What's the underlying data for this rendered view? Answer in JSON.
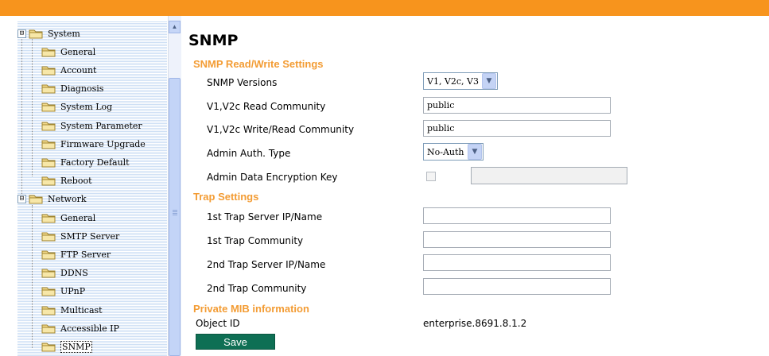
{
  "sidebar": {
    "groups": [
      {
        "label": "System",
        "expander": "⊟",
        "items": [
          "General",
          "Account",
          "Diagnosis",
          "System Log",
          "System Parameter",
          "Firmware Upgrade",
          "Factory Default",
          "Reboot"
        ]
      },
      {
        "label": "Network",
        "expander": "⊟",
        "items": [
          "General",
          "SMTP Server",
          "FTP Server",
          "DDNS",
          "UPnP",
          "Multicast",
          "Accessible IP",
          "SNMP"
        ]
      }
    ],
    "selected_item": "SNMP",
    "scroll_up_glyph": "▲"
  },
  "main": {
    "title": "SNMP",
    "rw_section": {
      "heading": "SNMP Read/Write Settings",
      "versions_label": "SNMP Versions",
      "versions_value": "V1, V2c, V3",
      "read_community_label": "V1,V2c Read Community",
      "read_community_value": "public",
      "write_community_label": "V1,V2c Write/Read Community",
      "write_community_value": "public",
      "auth_type_label": "Admin Auth. Type",
      "auth_type_value": "No-Auth",
      "encryption_key_label": "Admin Data Encryption Key",
      "encryption_key_checked": false,
      "encryption_key_value": ""
    },
    "trap_section": {
      "heading": "Trap Settings",
      "server1_label": "1st Trap Server IP/Name",
      "server1_value": "",
      "community1_label": "1st Trap Community",
      "community1_value": "",
      "server2_label": "2nd Trap Server IP/Name",
      "server2_value": "",
      "community2_label": "2nd Trap Community",
      "community2_value": ""
    },
    "mib_section": {
      "heading": "Private MIB information",
      "object_id_label": "Object ID",
      "object_id_value": "enterprise.8691.8.1.2"
    },
    "save_label": "Save",
    "dropdown_arrow": "▼"
  },
  "colors": {
    "top_bar": "#f7941d",
    "section_heading": "#f39c34",
    "save_button": "#0e6f54"
  },
  "icons": {
    "tree_folder": "folder-icon",
    "tree_expander": "collapse-icon",
    "dropdown": "chevron-down-icon",
    "scroll_up": "scroll-up-arrow-icon"
  }
}
